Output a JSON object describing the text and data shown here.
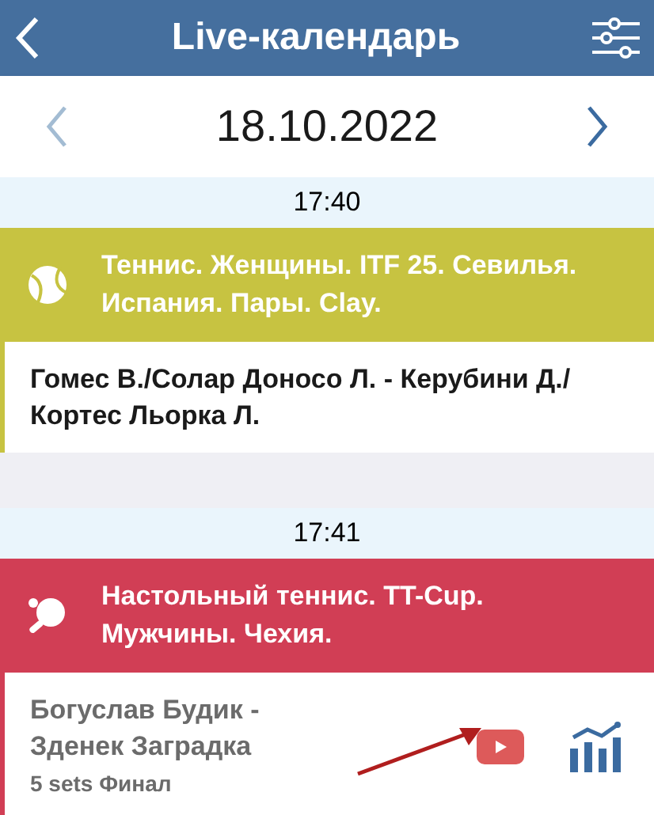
{
  "header": {
    "title": "Live-календарь"
  },
  "date_nav": {
    "date": "18.10.2022",
    "prev_disabled": true,
    "next_disabled": false
  },
  "sections": [
    {
      "time": "17:40",
      "kind": "tennis",
      "color": "#c7c341",
      "title": "Теннис. Женщины. ITF 25. Севилья. Испания. Пары. Clay.",
      "match": {
        "names": "Гомес В./Солар Доносо Л. - Керубини Д./ Кортес Льорка Л.",
        "dimmed": false,
        "video": false,
        "stats": false
      }
    },
    {
      "time": "17:41",
      "kind": "table_tennis",
      "color": "#d13e55",
      "title": "Настольный теннис. TT-Cup. Мужчины. Чехия.",
      "match": {
        "names": "Богуслав Будик - Зденек Заградка",
        "subtitle": "5 sets Финал",
        "dimmed": true,
        "video": true,
        "stats": true
      }
    }
  ]
}
